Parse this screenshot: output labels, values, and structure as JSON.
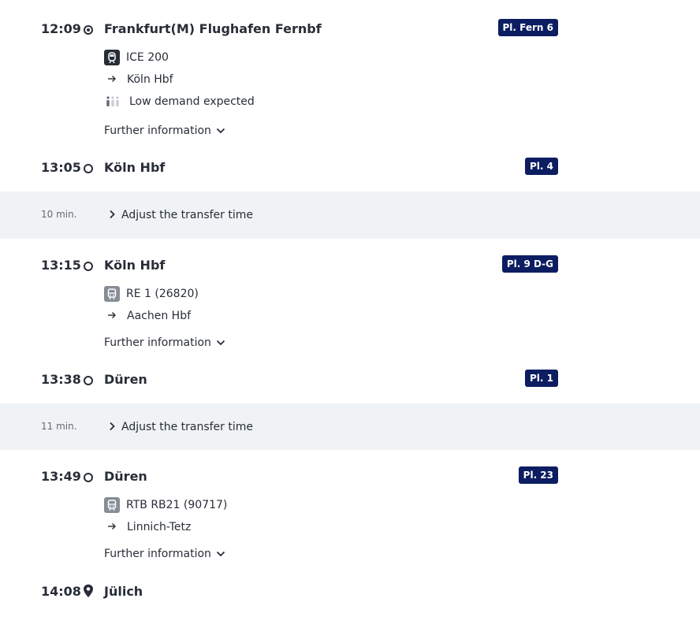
{
  "legs": [
    {
      "departure": {
        "time": "12:09",
        "station": "Frankfurt(M) Flughafen Fernbf",
        "platform": "Pl. Fern 6"
      },
      "train": {
        "type": "ice",
        "icon": "ice-train-icon",
        "label": "ICE 200"
      },
      "direction": "Köln Hbf",
      "demand": "Low demand expected",
      "further_info": "Further information",
      "arrival": {
        "time": "13:05",
        "station": "Köln Hbf",
        "platform": "Pl. 4"
      }
    },
    {
      "departure": {
        "time": "13:15",
        "station": "Köln Hbf",
        "platform": "Pl. 9 D-G"
      },
      "train": {
        "type": "regio",
        "icon": "regional-train-icon",
        "label": "RE 1 (26820)"
      },
      "direction": "Aachen Hbf",
      "further_info": "Further information",
      "arrival": {
        "time": "13:38",
        "station": "Düren",
        "platform": "Pl. 1"
      }
    },
    {
      "departure": {
        "time": "13:49",
        "station": "Düren",
        "platform": "Pl. 23"
      },
      "train": {
        "type": "regio",
        "icon": "regional-train-icon",
        "label": "RTB RB21 (90717)"
      },
      "direction": "Linnich-Tetz",
      "further_info": "Further information",
      "arrival": {
        "time": "14:08",
        "station": "Jülich"
      }
    }
  ],
  "transfers": [
    {
      "duration": "10 min.",
      "action": "Adjust the transfer time"
    },
    {
      "duration": "11 min.",
      "action": "Adjust the transfer time"
    }
  ],
  "colors": {
    "platform_bg": "#0c1d62",
    "transfer_bg": "#f0f3f5",
    "text": "#282d37"
  }
}
